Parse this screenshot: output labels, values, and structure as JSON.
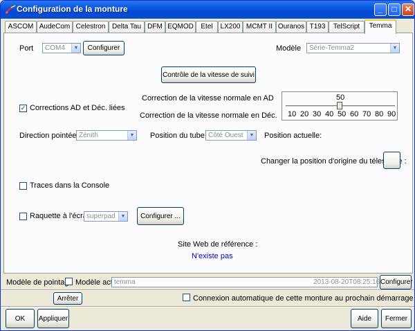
{
  "window": {
    "title": "Configuration de la monture"
  },
  "title_buttons": {
    "minimize": "_",
    "maximize": "□",
    "close": "✕"
  },
  "tabs": [
    {
      "label": "ASCOM"
    },
    {
      "label": "AudeCom"
    },
    {
      "label": "Celestron"
    },
    {
      "label": "Delta Tau"
    },
    {
      "label": "DFM"
    },
    {
      "label": "EQMOD"
    },
    {
      "label": "Etel"
    },
    {
      "label": "LX200"
    },
    {
      "label": "MCMT II"
    },
    {
      "label": "Ouranos"
    },
    {
      "label": "T193"
    },
    {
      "label": "TelScript"
    },
    {
      "label": "Temma",
      "active": true
    }
  ],
  "panel": {
    "port_label": "Port",
    "port_value": "COM4",
    "configure_label": "Configurer",
    "model_label": "Modèle",
    "model_value": "Série-Temma2",
    "tracking_button": "Contrôle de la vitesse de suivi",
    "corrections_label": "Corrections AD et Déc. liées",
    "corrections_checked": "✓",
    "correction_ad_label": "Correction de la vitesse normale en AD",
    "correction_dec_label": "Correction de la vitesse normale en Déc.",
    "slider": {
      "value_display": "50",
      "value": 50,
      "min": 10,
      "max": 90,
      "ticks": [
        "10",
        "20",
        "30",
        "40",
        "50",
        "60",
        "70",
        "80",
        "90"
      ]
    },
    "direction_label": "Direction pointée:",
    "direction_value": "Zénith",
    "tube_label": "Position du tube:",
    "tube_value": "Côté Ouest",
    "current_position_label": "Position actuelle:",
    "change_origin_label": "Changer la position d'origine du télescope :",
    "console_trace_label": "Traces dans la Console",
    "pad_label": "Raquette à l'écran",
    "pad_value": "superpad",
    "pad_configure_label": "Configurer ...",
    "website_label": "Site Web de référence :",
    "website_value": "N'existe pas"
  },
  "pointing": {
    "label": "Modèle de pointage",
    "active_label": "Modèle actif",
    "model_name": "temma",
    "timestamp": "2013-08-20T08:25:16",
    "configure_label": "Configurer"
  },
  "stop_button": "Arrêter",
  "auto_connect_label": "Connexion automatique de cette monture au prochain démarrage",
  "footer": {
    "ok": "OK",
    "apply": "Appliquer",
    "help": "Aide",
    "close": "Fermer"
  },
  "colors": {
    "title_bar": "#0a58e2",
    "checkmark": "#21a121",
    "link": "#0000cc",
    "active_tab_highlight": "#ffc83c"
  }
}
